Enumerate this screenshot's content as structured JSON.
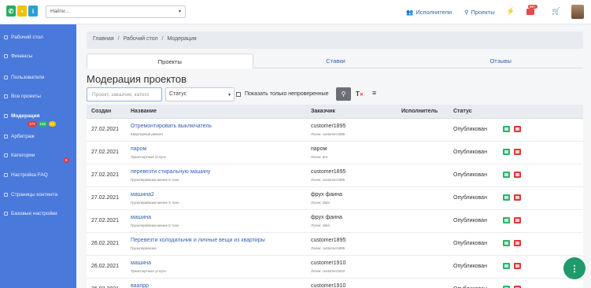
{
  "topbar": {
    "search_placeholder": "Найти...",
    "users_label": "Исполнители",
    "projects_label": "Проекты",
    "mail_badge": "99+",
    "colors": {
      "phone": "#27ae60",
      "note": "#f2c200",
      "info": "#2a9fd6"
    },
    "icons": [
      "phone-icon",
      "note-icon",
      "info-icon",
      "users-icon",
      "search-icon",
      "bolt-icon",
      "mail-icon",
      "cart-icon",
      "avatar"
    ]
  },
  "sidebar": {
    "items": [
      {
        "label": "Рабочий стол"
      },
      {
        "label": "Финансы"
      },
      {
        "label": "Пользователи"
      },
      {
        "label": "Все проекты"
      },
      {
        "label": "Модерация"
      },
      {
        "label": "Арбитраж"
      },
      {
        "label": "Категории"
      },
      {
        "label": "Настройка FAQ"
      },
      {
        "label": "Страницы контента"
      },
      {
        "label": "Базовые настройки"
      }
    ],
    "moderation_badges": [
      "173",
      "126",
      "21"
    ],
    "arbitrage_badge": "5",
    "color": "#4a79dc"
  },
  "breadcrumb": [
    "Главная",
    "Рабочий стол",
    "Модерация"
  ],
  "tabs": [
    "Проекты",
    "Ставки",
    "Отзывы"
  ],
  "page_title": "Модерация проектов",
  "filters": {
    "search_placeholder": "Проект, заказчик, катего",
    "status_value": "Статус",
    "only_unchecked_label": "Показать только непроверенные"
  },
  "table": {
    "headers": [
      "Создан",
      "Название",
      "Заказчик",
      "Исполнитель",
      "Статус"
    ],
    "rows": [
      {
        "date": "27.02.2021",
        "name": "Отремонтировать выключатель",
        "category": "Квартирный ремонт",
        "customer": "customer1895",
        "login": "Логин: customer1895",
        "executor": "",
        "status": "Опубликован"
      },
      {
        "date": "27.02.2021",
        "name": "паром",
        "category": "Транспортные услуги",
        "customer": "паром",
        "login": "Логин: ant",
        "executor": "",
        "status": "Опубликован"
      },
      {
        "date": "27.02.2021",
        "name": "перевезти стиральную машину",
        "category": "Грузоперевозки менее 5 тонн",
        "customer": "customer1895",
        "login": "Логин: customer1895",
        "executor": "",
        "status": "Опубликован"
      },
      {
        "date": "27.02.2021",
        "name": "машина2",
        "category": "Грузоперевозки менее 5 тонн",
        "customer": "фрух фаина",
        "login": "Логин: slst4",
        "executor": "",
        "status": "Опубликован"
      },
      {
        "date": "27.02.2021",
        "name": "машина",
        "category": "Грузоперевозки менее 5 тонн",
        "customer": "фрух фаина",
        "login": "Логин: slst4",
        "executor": "",
        "status": "Опубликован"
      },
      {
        "date": "26.02.2021",
        "name": "Перевезти холодильник и личные вещи из квартиры",
        "category": "Грузоперевозки",
        "customer": "customer1895",
        "login": "Логин: customer1895",
        "executor": "",
        "status": "Опубликован"
      },
      {
        "date": "26.02.2021",
        "name": "машина",
        "category": "Транспортные услуги",
        "customer": "customer1910",
        "login": "Логин: customer1910",
        "executor": "",
        "status": "Опубликован"
      },
      {
        "date": "26.02.2021",
        "name": "ваапрр",
        "category": "Грузоперевозки",
        "customer": "customer1910",
        "login": "Логин: customer1910",
        "executor": "",
        "status": "Опубликован"
      }
    ]
  }
}
